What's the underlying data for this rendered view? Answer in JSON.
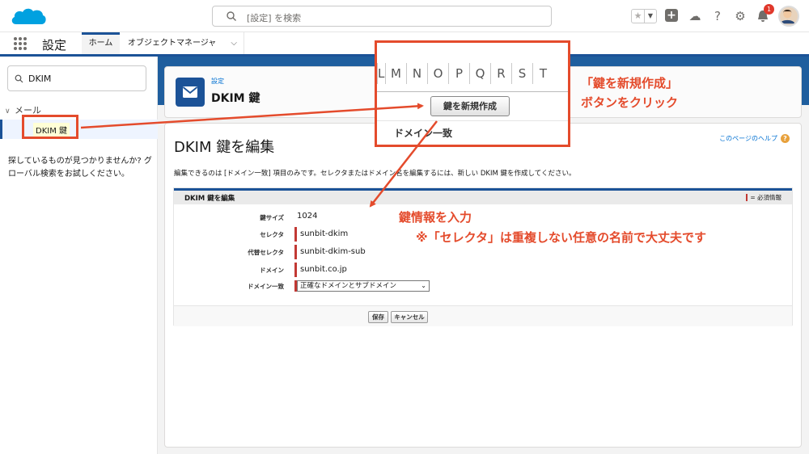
{
  "header": {
    "search_placeholder": "[設定] を検索",
    "notification_count": "1"
  },
  "nav": {
    "app_name": "設定",
    "tabs": [
      {
        "label": "ホーム"
      },
      {
        "label": "オブジェクトマネージャ"
      }
    ]
  },
  "sidebar": {
    "quick_find_value": "DKIM",
    "section_label": "メール",
    "selected_item": "DKIM 鍵",
    "not_found_text": "探しているものが見つかりませんか? グローバル検索をお試しください。"
  },
  "page_header": {
    "breadcrumb": "設定",
    "title": "DKIM 鍵"
  },
  "main": {
    "title": "DKIM 鍵を編集",
    "help_link": "このページのヘルプ",
    "info_text": "編集できるのは [ドメイン一致] 項目のみです。セレクタまたはドメイン名を編集するには、新しい DKIM 鍵を作成してください。",
    "section_title": "DKIM 鍵を編集",
    "required_legend": "= 必須情報",
    "fields": [
      {
        "label": "鍵サイズ",
        "value": "1024"
      },
      {
        "label": "セレクタ",
        "value": "sunbit-dkim"
      },
      {
        "label": "代替セレクタ",
        "value": "sunbit-dkim-sub"
      },
      {
        "label": "ドメイン",
        "value": "sunbit.co.jp"
      },
      {
        "label": "ドメイン一致",
        "value": "正確なドメインとサブドメイン"
      }
    ],
    "save_label": "保存",
    "cancel_label": "キャンセル"
  },
  "zoom_callout": {
    "letters": [
      "L",
      "M",
      "N",
      "O",
      "P",
      "Q",
      "R",
      "S",
      "T"
    ],
    "new_key_button": "鍵を新規作成",
    "column_header": "ドメイン一致"
  },
  "annotations": {
    "click_line1": "「鍵を新規作成」",
    "click_line2": "ボタンをクリック",
    "enter_info": "鍵情報を入力",
    "selector_note": "※「セレクタ」は重複しない任意の名前で大丈夫です"
  },
  "colors": {
    "annotation_red": "#e44b2c",
    "brand_blue": "#1b5297",
    "link_blue": "#0070d2",
    "required_red": "#c23934"
  }
}
